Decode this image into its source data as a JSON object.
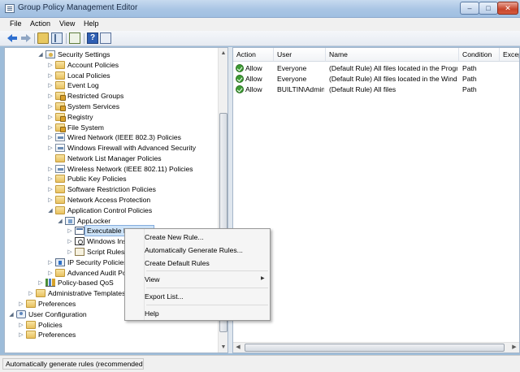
{
  "window": {
    "title": "Group Policy Management Editor",
    "min_glyph": "–",
    "max_glyph": "□",
    "close_glyph": "✕"
  },
  "menu": [
    "File",
    "Action",
    "View",
    "Help"
  ],
  "toolbar": {
    "help_glyph": "?"
  },
  "tree": [
    {
      "label": "Security Settings",
      "icon": "security-settings-icon",
      "expanded": true
    },
    {
      "label": "Account Policies",
      "icon": "folder-icon"
    },
    {
      "label": "Local Policies",
      "icon": "folder-icon"
    },
    {
      "label": "Event Log",
      "icon": "folder-icon"
    },
    {
      "label": "Restricted Groups",
      "icon": "locked-folder-icon"
    },
    {
      "label": "System Services",
      "icon": "locked-folder-icon"
    },
    {
      "label": "Registry",
      "icon": "locked-folder-icon"
    },
    {
      "label": "File System",
      "icon": "locked-folder-icon"
    },
    {
      "label": "Wired Network (IEEE 802.3) Policies",
      "icon": "network-policy-icon"
    },
    {
      "label": "Windows Firewall with Advanced Security",
      "icon": "network-policy-icon"
    },
    {
      "label": "Network List Manager Policies",
      "icon": "folder-icon"
    },
    {
      "label": "Wireless Network (IEEE 802.11) Policies",
      "icon": "network-policy-icon"
    },
    {
      "label": "Public Key Policies",
      "icon": "folder-icon"
    },
    {
      "label": "Software Restriction Policies",
      "icon": "folder-icon"
    },
    {
      "label": "Network Access Protection",
      "icon": "folder-icon"
    },
    {
      "label": "Application Control Policies",
      "icon": "folder-icon",
      "expanded": true
    },
    {
      "label": "AppLocker",
      "icon": "applocker-icon",
      "expanded": true
    },
    {
      "label": "Executable Rules",
      "icon": "executable-rules-icon",
      "selected": true
    },
    {
      "label": "Windows Installer Rules",
      "icon": "windows-installer-icon"
    },
    {
      "label": "Script Rules",
      "icon": "script-rules-icon"
    },
    {
      "label": "IP Security Policies on Active Directory",
      "icon": "ip-security-icon"
    },
    {
      "label": "Advanced Audit Policy Configuration",
      "icon": "folder-icon"
    },
    {
      "label": "Policy-based QoS",
      "icon": "qos-icon"
    },
    {
      "label": "Administrative Templates",
      "icon": "folder-icon"
    },
    {
      "label": "Preferences",
      "icon": "folder-icon"
    },
    {
      "label": "User Configuration",
      "icon": "user-config-icon",
      "expanded": true
    },
    {
      "label": "Policies",
      "icon": "folder-icon"
    },
    {
      "label": "Preferences",
      "icon": "folder-icon"
    }
  ],
  "table": {
    "columns": [
      "Action",
      "User",
      "Name",
      "Condition",
      "Exceptions"
    ],
    "rows": [
      {
        "action": "Allow",
        "user": "Everyone",
        "name": "(Default Rule) All files located in the Program Files folder",
        "condition": "Path",
        "exceptions": ""
      },
      {
        "action": "Allow",
        "user": "Everyone",
        "name": "(Default Rule) All files located in the Windows folder",
        "condition": "Path",
        "exceptions": ""
      },
      {
        "action": "Allow",
        "user": "BUILTIN\\Administrators",
        "name": "(Default Rule) All files",
        "condition": "Path",
        "exceptions": ""
      }
    ]
  },
  "context_menu": {
    "items": [
      "Create New Rule...",
      "Automatically Generate Rules...",
      "Create Default Rules",
      "View",
      "Export List...",
      "Help"
    ],
    "submenu_glyph": "▶"
  },
  "status": {
    "text": "Automatically generate rules (recommended)"
  }
}
